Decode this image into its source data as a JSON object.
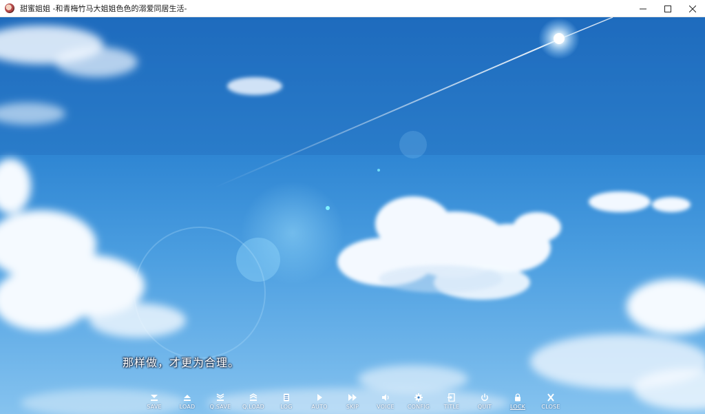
{
  "window": {
    "title": "甜蜜姐姐 -和青梅竹马大姐姐色色的溺爱同居生活-",
    "controls": [
      "minimize-icon",
      "maximize-icon",
      "close-icon"
    ]
  },
  "dialogue": {
    "text": "那样做，才更为合理。"
  },
  "quick_menu": {
    "items": [
      {
        "label": "SAVE",
        "icon": "save-icon"
      },
      {
        "label": "LOAD",
        "icon": "load-icon"
      },
      {
        "label": "Q.SAVE",
        "icon": "quick-save-icon"
      },
      {
        "label": "Q.LOAD",
        "icon": "quick-load-icon"
      },
      {
        "label": "LOG",
        "icon": "log-icon"
      },
      {
        "label": "AUTO",
        "icon": "play-icon"
      },
      {
        "label": "SKIP",
        "icon": "fast-forward-icon"
      },
      {
        "label": "VOICE",
        "icon": "speaker-icon"
      },
      {
        "label": "CONFIG",
        "icon": "gear-icon"
      },
      {
        "label": "TITLE",
        "icon": "exit-to-title-icon"
      },
      {
        "label": "QUIT",
        "icon": "power-icon"
      },
      {
        "label": "LOCK",
        "icon": "lock-icon"
      },
      {
        "label": "CLOSE",
        "icon": "close-x-icon"
      }
    ]
  }
}
